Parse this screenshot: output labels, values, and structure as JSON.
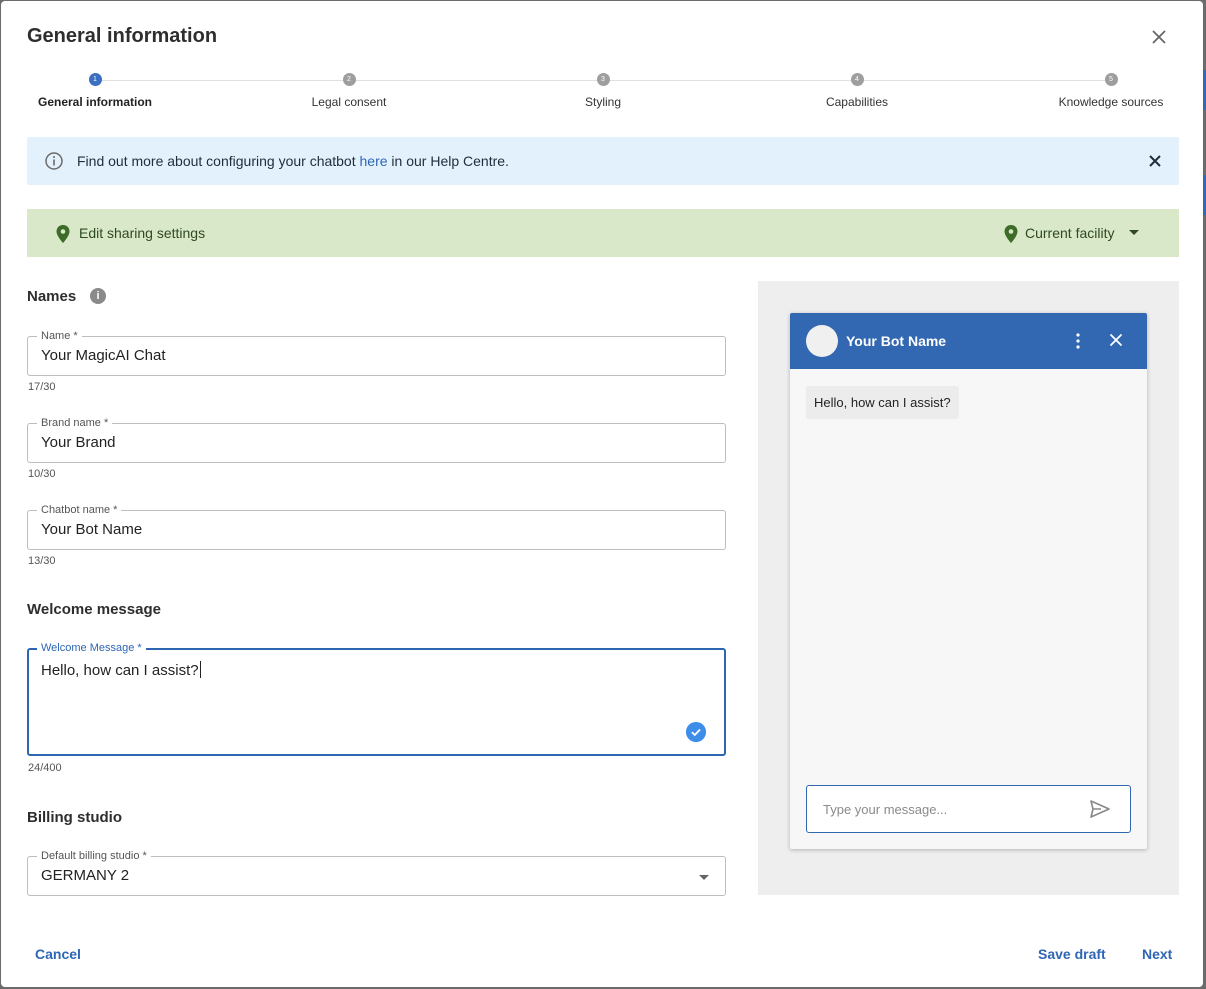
{
  "dialog": {
    "title": "General information"
  },
  "stepper": {
    "steps": [
      {
        "num": "1",
        "label": "General information",
        "active": true
      },
      {
        "num": "2",
        "label": "Legal consent",
        "active": false
      },
      {
        "num": "3",
        "label": "Styling",
        "active": false
      },
      {
        "num": "4",
        "label": "Capabilities",
        "active": false
      },
      {
        "num": "5",
        "label": "Knowledge sources",
        "active": false
      }
    ]
  },
  "info_banner": {
    "text_before": "Find out more about configuring your chatbot ",
    "link_text": "here",
    "text_after": " in our Help Centre."
  },
  "sharing": {
    "edit_label": "Edit sharing settings",
    "facility_label": "Current facility"
  },
  "names": {
    "section_title": "Names",
    "help_glyph": "i",
    "name": {
      "label": "Name *",
      "value": "Your MagicAI Chat",
      "counter": "17/30"
    },
    "brand": {
      "label": "Brand name *",
      "value": "Your Brand",
      "counter": "10/30"
    },
    "chatbot": {
      "label": "Chatbot name *",
      "value": "Your Bot Name",
      "counter": "13/30"
    }
  },
  "welcome": {
    "section_title": "Welcome message",
    "label": "Welcome Message *",
    "value": "Hello, how can I assist?",
    "counter": "24/400"
  },
  "billing": {
    "section_title": "Billing studio",
    "label": "Default billing studio *",
    "value": "GERMANY 2"
  },
  "preview": {
    "bot_name": "Your Bot Name",
    "greeting": "Hello, how can I assist?",
    "input_placeholder": "Type your message..."
  },
  "footer": {
    "cancel": "Cancel",
    "save_draft": "Save draft",
    "next": "Next"
  },
  "colors": {
    "accent": "#2e66b4",
    "header_blue": "#3268b2",
    "info_bg": "#e3f1fd",
    "share_bg": "#d9e8c9",
    "share_text": "#2f4a21"
  },
  "icons": [
    "close-icon",
    "info-icon",
    "location-pin-icon",
    "chevron-down-icon",
    "help-icon",
    "check-circle-icon",
    "more-vert-icon",
    "send-icon"
  ]
}
